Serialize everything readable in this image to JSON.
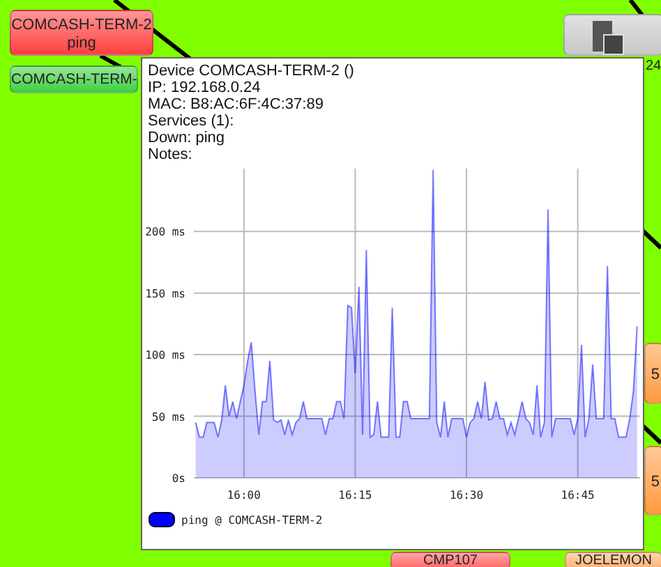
{
  "map_nodes": [
    {
      "kind": "node",
      "color": "#ff4040",
      "label": "COMCASH-TERM-2",
      "service": "ping"
    },
    {
      "kind": "node",
      "color": "#40d040",
      "label": "COMCASH-TERM-"
    },
    {
      "kind": "device",
      "color": "#c8c8c8",
      "label": "24"
    },
    {
      "kind": "edge",
      "color": "#ff9a40",
      "label": "5"
    },
    {
      "kind": "edge",
      "color": "#ff9a40",
      "label": "5"
    },
    {
      "kind": "bottom",
      "color": "#ff6060",
      "label": "CMP107"
    },
    {
      "kind": "bottom",
      "color": "#ffb070",
      "label": "JOELEMON"
    }
  ],
  "tooltip": {
    "lines": [
      "Device COMCASH-TERM-2 ()",
      "IP: 192.168.0.24",
      "MAC: B8:AC:6F:4C:37:89",
      "Services (1):",
      "Down: ping",
      "Notes:"
    ],
    "chart_data": {
      "type": "area",
      "grid": true,
      "ylim": [
        0,
        251
      ],
      "yticks": [
        {
          "value": 0,
          "label": "0s"
        },
        {
          "value": 50,
          "label": "50 ms"
        },
        {
          "value": 100,
          "label": "100 ms"
        },
        {
          "value": 150,
          "label": "150 ms"
        },
        {
          "value": 200,
          "label": "200 ms"
        }
      ],
      "categories": [
        null,
        null,
        null,
        null,
        null,
        null,
        null,
        null,
        null,
        null,
        null,
        null,
        null,
        "16:00",
        null,
        null,
        null,
        null,
        null,
        null,
        null,
        null,
        null,
        null,
        null,
        null,
        null,
        null,
        null,
        null,
        null,
        null,
        null,
        null,
        null,
        null,
        null,
        null,
        null,
        null,
        null,
        null,
        null,
        "16:15",
        null,
        null,
        null,
        null,
        null,
        null,
        null,
        null,
        null,
        null,
        null,
        null,
        null,
        null,
        null,
        null,
        null,
        null,
        null,
        null,
        null,
        null,
        null,
        null,
        null,
        null,
        null,
        null,
        null,
        "16:30",
        null,
        null,
        null,
        null,
        null,
        null,
        null,
        null,
        null,
        null,
        null,
        null,
        null,
        null,
        null,
        null,
        null,
        null,
        null,
        null,
        null,
        null,
        null,
        null,
        null,
        null,
        null,
        null,
        null,
        "16:45",
        null,
        null,
        null,
        null,
        null,
        null,
        null,
        null,
        null,
        null,
        null,
        null,
        null,
        null,
        null,
        null
      ],
      "series": [
        {
          "name": "ping @ COMCASH-TERM-2",
          "color": "#0000ff",
          "values": [
            45,
            33,
            33,
            45,
            45,
            45,
            33,
            47,
            75,
            50,
            62,
            48,
            62,
            75,
            95,
            110,
            70,
            35,
            62,
            62,
            95,
            47,
            45,
            47,
            35,
            47,
            35,
            45,
            48,
            62,
            48,
            48,
            48,
            48,
            48,
            35,
            48,
            48,
            62,
            62,
            48,
            140,
            138,
            85,
            155,
            35,
            185,
            33,
            35,
            62,
            33,
            33,
            33,
            138,
            33,
            33,
            62,
            62,
            48,
            48,
            48,
            48,
            48,
            48,
            250,
            45,
            33,
            62,
            33,
            48,
            48,
            48,
            48,
            33,
            45,
            48,
            62,
            48,
            78,
            47,
            48,
            62,
            48,
            48,
            35,
            45,
            35,
            48,
            62,
            48,
            45,
            35,
            75,
            33,
            45,
            218,
            33,
            48,
            48,
            48,
            48,
            48,
            35,
            48,
            108,
            33,
            48,
            92,
            48,
            48,
            48,
            172,
            48,
            48,
            33,
            33,
            33,
            48,
            70,
            123
          ]
        }
      ]
    }
  }
}
